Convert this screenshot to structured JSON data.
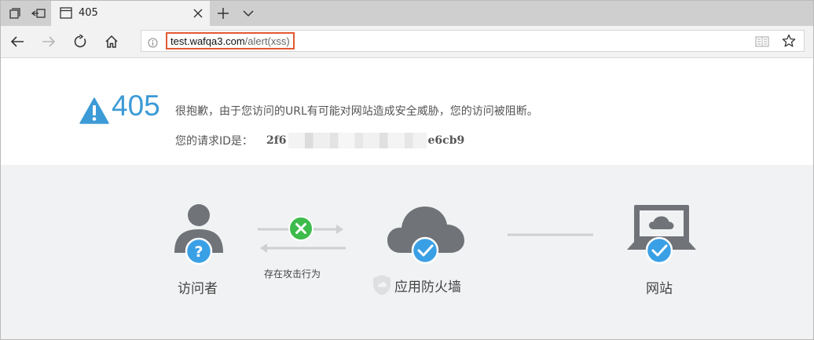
{
  "tab": {
    "title": "405"
  },
  "address": {
    "host": "test.wafqa3.com",
    "path": "/alert(xss)"
  },
  "error": {
    "code": "405",
    "message": "很抱歉，由于您访问的URL有可能对网站造成安全威胁，您的访问被阻断。",
    "request_id_label": "您的请求ID是：",
    "request_id_prefix": "2f6",
    "request_id_suffix": "e6cb9"
  },
  "diagram": {
    "visitor_label": "访问者",
    "attack_label": "存在攻击行为",
    "waf_label": "应用防火墙",
    "site_label": "网站"
  },
  "colors": {
    "accent_blue": "#3c9ad6",
    "check_blue": "#3aa0e6",
    "block_green": "#3dbb4b",
    "icon_gray": "#707378",
    "highlight_red": "#e05a33"
  }
}
